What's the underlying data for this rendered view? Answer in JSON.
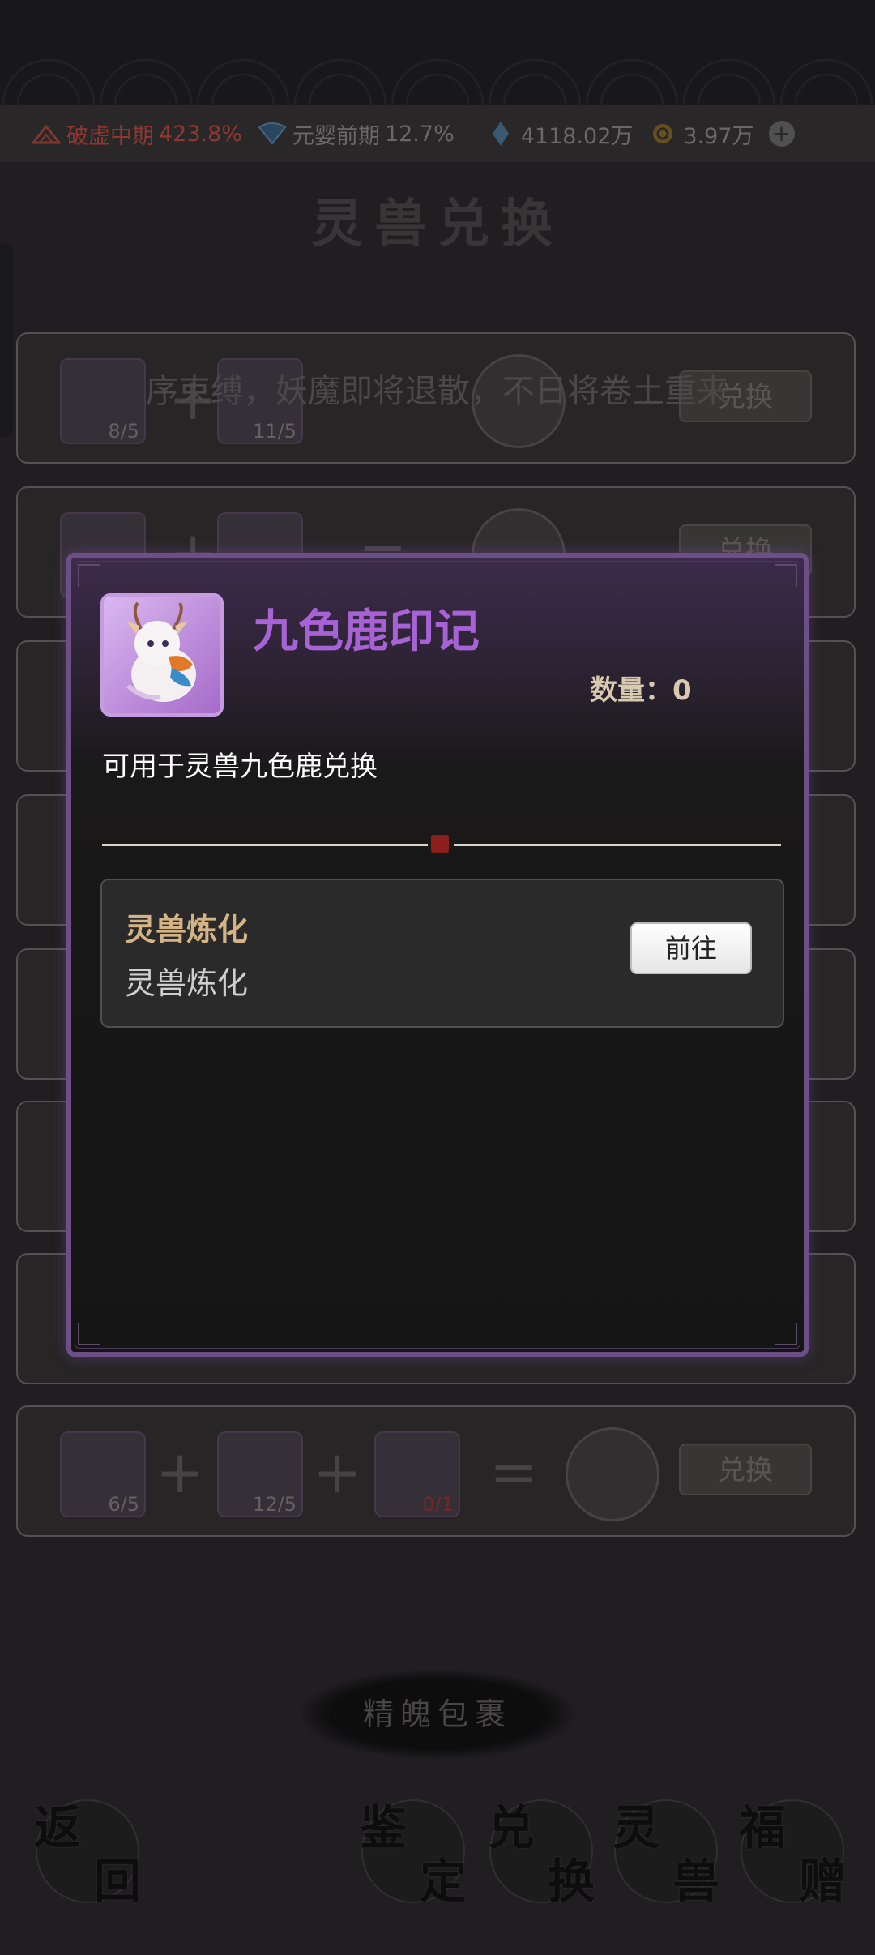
{
  "status_bar": {
    "realm1": "破虚中期",
    "realm1_pct": "423.8%",
    "realm2": "元婴前期",
    "realm2_pct": "12.7%",
    "spirit_stones": "4118.02万",
    "coins": "3.97万",
    "icons": [
      "mountain-icon",
      "fan-icon",
      "crystal-icon",
      "coin-icon",
      "plus-icon"
    ]
  },
  "page": {
    "title": "灵兽兑换",
    "notice": "序束缚，妖魔即将退散，不日将卷土重来",
    "exchange_label": "兑换",
    "rows": [
      {
        "a": "8/5",
        "b": "11/5",
        "c": null
      },
      {
        "a": "",
        "b": "",
        "c": null
      },
      {
        "a": "6/5",
        "b": "12/5",
        "c": "0/1"
      }
    ],
    "bundle_label": "精魄包裹"
  },
  "bottom_nav": {
    "back": [
      "返",
      "回"
    ],
    "identify": [
      "鉴",
      "定"
    ],
    "exchange": [
      "兑",
      "换"
    ],
    "beast": [
      "灵",
      "兽"
    ],
    "gift": [
      "福",
      "赠"
    ]
  },
  "dialog": {
    "item_name": "九色鹿印记",
    "quantity": "数量：0",
    "description": "可用于灵兽九色鹿兑换",
    "source": {
      "title": "灵兽炼化",
      "subtitle": "灵兽炼化",
      "button": "前往"
    }
  },
  "colors": {
    "dialog_border": "#6d4f88",
    "item_name": "#a763d6",
    "source_title": "#d3b486"
  }
}
